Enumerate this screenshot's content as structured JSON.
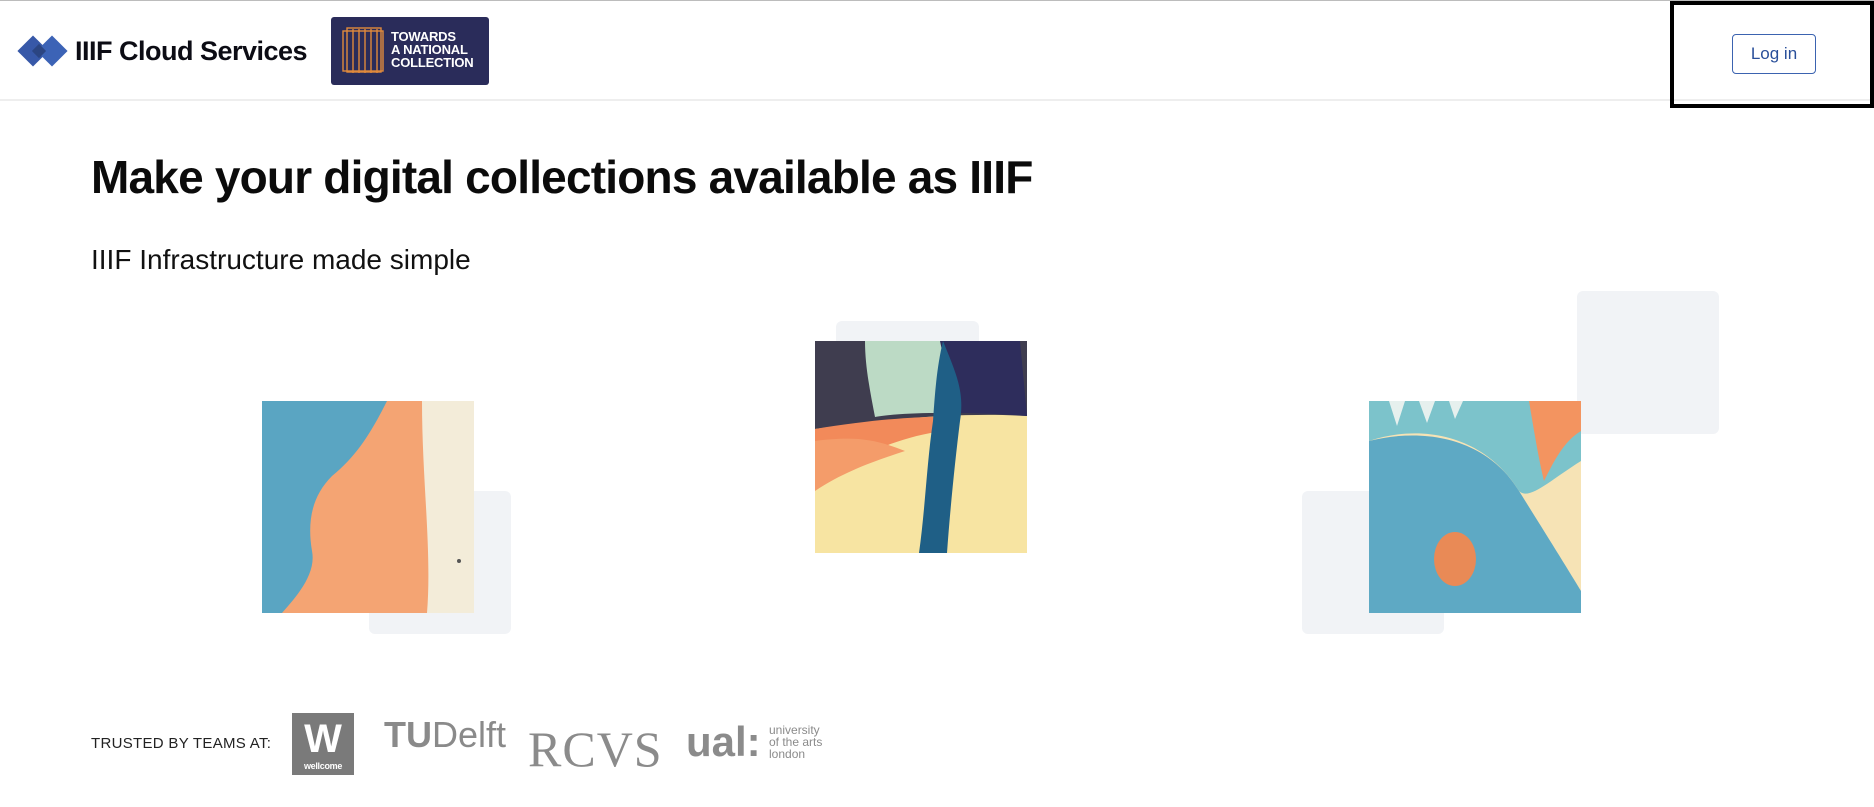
{
  "header": {
    "brand_name": "IIIF Cloud Services",
    "brand_icon": "iiif-diamond-logo-icon",
    "partner_logo_lines": [
      "TOWARDS",
      "A NATIONAL",
      "COLLECTION"
    ],
    "login_label": "Log in"
  },
  "hero": {
    "title": "Make your digital collections available as IIIF",
    "subtitle": "IIIF Infrastructure made simple"
  },
  "trusted": {
    "label": "TRUSTED BY TEAMS AT:",
    "logos": {
      "wellcome_mark": "W",
      "wellcome_name": "wellcome",
      "tudelft_tu": "TU",
      "tudelft_rest": "Delft",
      "rcvs": "RCVS",
      "ual_mark": "ual:",
      "ual_lines": [
        "university",
        "of the arts",
        "london"
      ]
    }
  },
  "colors": {
    "brand_blue": "#3758a8",
    "partner_bg": "#2a2c5a",
    "login_border": "#3b63b0",
    "logo_gray": "#8b8b8b"
  }
}
